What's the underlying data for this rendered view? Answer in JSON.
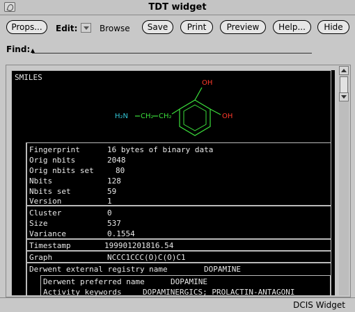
{
  "window": {
    "title": "TDT widget"
  },
  "toolbar": {
    "props_label": "Props...",
    "edit_label": "Edit:",
    "browse_label": "Browse",
    "save_label": "Save",
    "print_label": "Print",
    "preview_label": "Preview",
    "help_label": "Help...",
    "hide_label": "Hide"
  },
  "find": {
    "label": "Find:",
    "value": ""
  },
  "smiles": {
    "label": "SMILES",
    "molecule": {
      "oh_top": "OH",
      "oh_right": "OH",
      "amine": "H₂N",
      "ch2_1": "CH₂",
      "ch2_2": "CH₂"
    }
  },
  "fingerprint": [
    {
      "key": "Fingerprint",
      "value": "16 bytes of binary data"
    },
    {
      "key": "Orig nbits",
      "value": "2048"
    },
    {
      "key": "Orig nbits set",
      "value": "80"
    },
    {
      "key": "Nbits",
      "value": "128"
    },
    {
      "key": "Nbits set",
      "value": "59"
    },
    {
      "key": "Version",
      "value": "1"
    }
  ],
  "cluster": [
    {
      "key": "Cluster",
      "value": "0"
    },
    {
      "key": "Size",
      "value": "537"
    },
    {
      "key": "Variance",
      "value": "0.1554"
    }
  ],
  "timestamp": {
    "key": "Timestamp",
    "value": "199901201816.54"
  },
  "graph": {
    "key": "Graph",
    "value": "NCCC1CCC(O)C(O)C1"
  },
  "derwent": {
    "registry": {
      "key": "Derwent external registry name",
      "value": "DOPAMINE"
    },
    "preferred": {
      "key": "Derwent preferred name",
      "value": "DOPAMINE"
    },
    "activity": {
      "key": "Activity keywords",
      "value": "DOPAMINERGICS; PROLACTIN-ANTAGONI"
    }
  },
  "status": {
    "text": "DCIS Widget"
  },
  "colors": {
    "panel_bg": "#000000",
    "amine": "#33c8d8",
    "carbon": "#3ce03c",
    "oxygen": "#ff3a2a",
    "text": "#e8e8e8"
  }
}
